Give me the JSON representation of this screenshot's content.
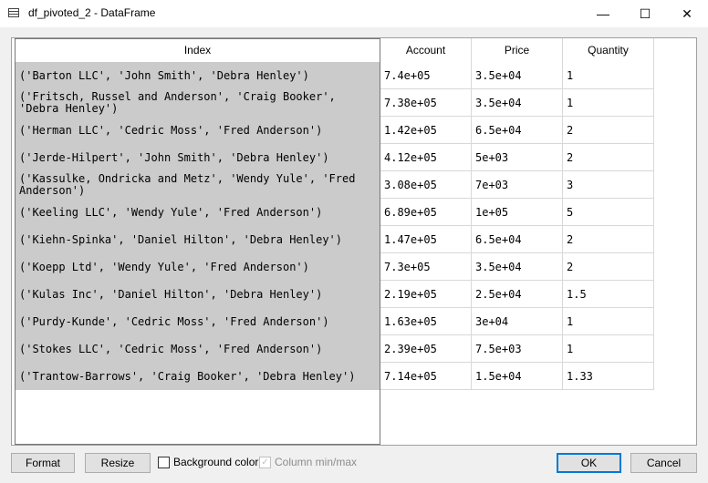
{
  "window": {
    "title": "df_pivoted_2 - DataFrame",
    "minimize_glyph": "—",
    "maximize_glyph": "☐",
    "close_glyph": "✕"
  },
  "table": {
    "index_header": "Index",
    "columns": [
      "Account",
      "Price",
      "Quantity"
    ],
    "rows": [
      {
        "index": "('Barton LLC', 'John Smith', 'Debra Henley')",
        "values": [
          "7.4e+05",
          "3.5e+04",
          "1"
        ]
      },
      {
        "index": "('Fritsch, Russel and Anderson', 'Craig Booker', 'Debra Henley')",
        "values": [
          "7.38e+05",
          "3.5e+04",
          "1"
        ]
      },
      {
        "index": "('Herman LLC', 'Cedric Moss', 'Fred Anderson')",
        "values": [
          "1.42e+05",
          "6.5e+04",
          "2"
        ]
      },
      {
        "index": "('Jerde-Hilpert', 'John Smith', 'Debra Henley')",
        "values": [
          "4.12e+05",
          "5e+03",
          "2"
        ]
      },
      {
        "index": "('Kassulke, Ondricka and Metz', 'Wendy Yule', 'Fred Anderson')",
        "values": [
          "3.08e+05",
          "7e+03",
          "3"
        ]
      },
      {
        "index": "('Keeling LLC', 'Wendy Yule', 'Fred Anderson')",
        "values": [
          "6.89e+05",
          "1e+05",
          "5"
        ]
      },
      {
        "index": "('Kiehn-Spinka', 'Daniel Hilton', 'Debra Henley')",
        "values": [
          "1.47e+05",
          "6.5e+04",
          "2"
        ]
      },
      {
        "index": "('Koepp Ltd', 'Wendy Yule', 'Fred Anderson')",
        "values": [
          "7.3e+05",
          "3.5e+04",
          "2"
        ]
      },
      {
        "index": "('Kulas Inc', 'Daniel Hilton', 'Debra Henley')",
        "values": [
          "2.19e+05",
          "2.5e+04",
          "1.5"
        ]
      },
      {
        "index": "('Purdy-Kunde', 'Cedric Moss', 'Fred Anderson')",
        "values": [
          "1.63e+05",
          "3e+04",
          "1"
        ]
      },
      {
        "index": "('Stokes LLC', 'Cedric Moss', 'Fred Anderson')",
        "values": [
          "2.39e+05",
          "7.5e+03",
          "1"
        ]
      },
      {
        "index": "('Trantow-Barrows', 'Craig Booker', 'Debra Henley')",
        "values": [
          "7.14e+05",
          "1.5e+04",
          "1.33"
        ]
      }
    ]
  },
  "footer": {
    "format_label": "Format",
    "resize_label": "Resize",
    "background_color_label": "Background color",
    "background_color_checked": false,
    "column_minmax_label": "Column min/max",
    "column_minmax_checked": true,
    "column_minmax_enabled": false,
    "ok_label": "OK",
    "cancel_label": "Cancel"
  }
}
